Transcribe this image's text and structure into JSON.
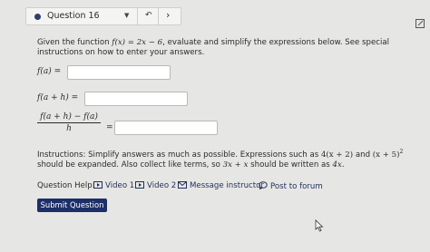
{
  "header": {
    "question_label": "Question 16",
    "dropdown_icon": "caret-down-icon",
    "undo_icon": "undo-icon",
    "next_icon": "chevron-right-icon",
    "corner_icon": "edit-icon"
  },
  "question": {
    "intro_before": "Given the function ",
    "function_lhs": "f(x)",
    "function_rhs": "2x − 6",
    "intro_after": ", evaluate and simplify the expressions below. See special instructions on how to enter your answers."
  },
  "expressions": {
    "fa": "f(a) =",
    "fah": "f(a + h) =",
    "diff_numerator": "f(a + h) − f(a)",
    "diff_denominator": "h",
    "diff_equals": "="
  },
  "answers": {
    "fa_value": "",
    "fah_value": "",
    "diff_value": ""
  },
  "instructions": {
    "text1": "Instructions: Simplify answers as much as possible. Expressions such as ",
    "ex1": "4(x + 2)",
    "and": " and ",
    "ex2_base": "(x + 5)",
    "ex2_exp": "2",
    "text2": " should be expanded. Also collect like terms, so ",
    "ex3": "3x + x",
    "text3": " should be written as ",
    "ex4": "4x",
    "end": "."
  },
  "help": {
    "label": "Question Help:",
    "video1": "Video 1",
    "video2": "Video 2",
    "message": "Message instructor",
    "forum": "Post to forum"
  },
  "submit_label": "Submit Question",
  "colors": {
    "accent": "#1c2f68",
    "background": "#e6e6e4"
  }
}
